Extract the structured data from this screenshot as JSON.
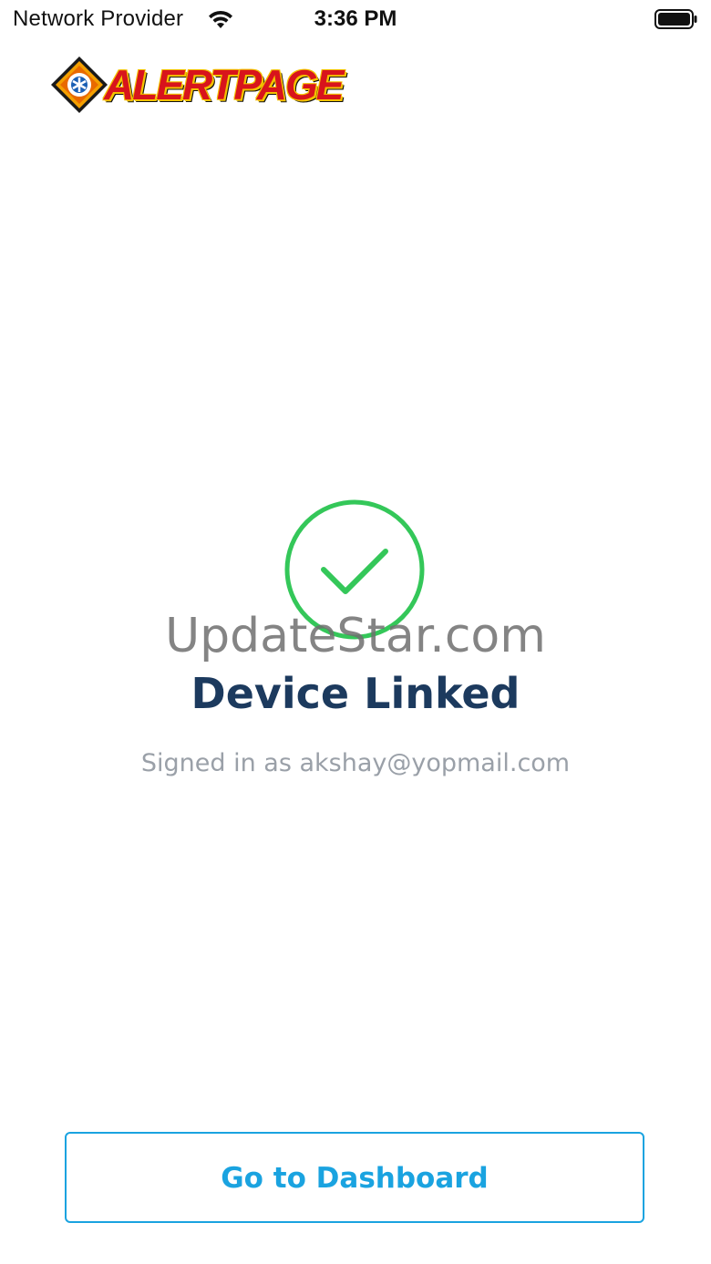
{
  "status_bar": {
    "carrier": "Network Provider",
    "time": "3:36 PM",
    "wifi_icon": "wifi-icon",
    "battery_icon": "battery-icon"
  },
  "logo": {
    "text": "ALERTPAGE",
    "icon": "alertpage-emblem-icon"
  },
  "success": {
    "icon": "check-circle-icon",
    "accent_color": "#34c759",
    "title": "Device Linked",
    "subtitle": "Signed in as akshay@yopmail.com"
  },
  "watermark": "UpdateStar.com",
  "actions": {
    "dashboard_label": "Go to Dashboard",
    "button_color": "#1aa3e0"
  },
  "colors": {
    "title": "#1c3a5e",
    "subtitle": "#9aa0a8",
    "logo_red": "#d8141c",
    "logo_yellow": "#f4c200"
  }
}
